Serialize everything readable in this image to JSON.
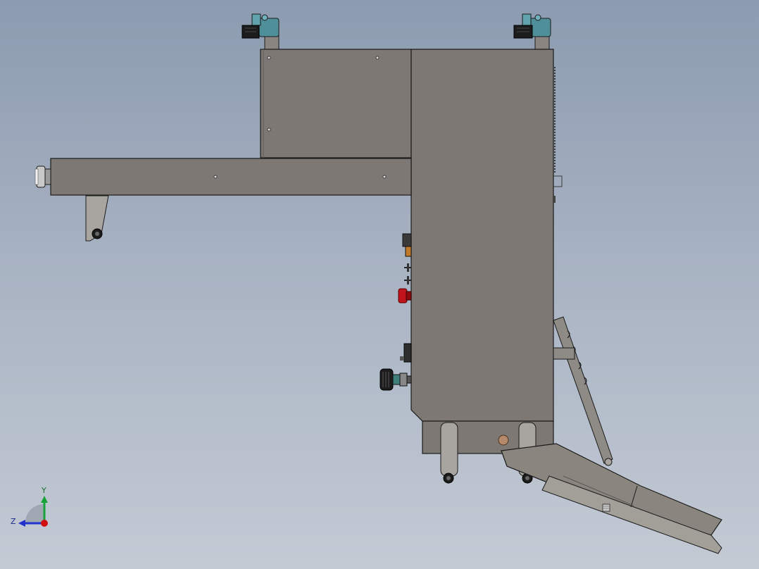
{
  "viewport": {
    "background_top": "#8c9bb0",
    "background_bottom": "#c3cad4"
  },
  "colors": {
    "body_fill": "#7d7874",
    "body_stroke": "#1b1b1b",
    "clamp_teal": "#4f8f99",
    "rubber_black": "#1c1c1c",
    "emergency_red": "#c0141c",
    "knob_bronze": "#b58a6a",
    "chute_fill": "#8a857f"
  },
  "triad": {
    "y_label": "Y",
    "z_label": "Z",
    "y_axis_color": "#17a33a",
    "z_axis_color": "#2233cc",
    "x_axis_color": "#d01010"
  },
  "icons": {
    "clamp": "toggle-clamp-icon",
    "wheel": "caster-wheel-icon",
    "button": "emergency-stop-icon"
  }
}
